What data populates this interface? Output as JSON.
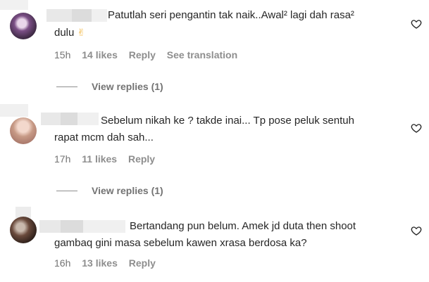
{
  "comments": [
    {
      "text_line1": "Patutlah seri pengantin tak naik..Awal² lagi dah rasa²",
      "text_line2": "dulu",
      "emoji": "✌",
      "time": "15h",
      "likes": "14 likes",
      "reply": "Reply",
      "translate": "See translation",
      "view_replies": "View replies (1)"
    },
    {
      "text_line1": "Sebelum nikah ke ? takde inai... Tp pose peluk sentuh",
      "text_line2": "rapat mcm dah sah...",
      "time": "17h",
      "likes": "11 likes",
      "reply": "Reply",
      "view_replies": "View replies (1)"
    },
    {
      "text_line1": "Bertandang pun belum. Amek jd duta then shoot",
      "text_line2": "gambaq gini masa sebelum kawen xrasa berdosa ka?",
      "time": "16h",
      "likes": "13 likes",
      "reply": "Reply"
    }
  ],
  "icons": {
    "like": "heart-icon"
  }
}
